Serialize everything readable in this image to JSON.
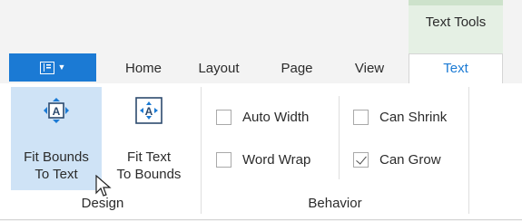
{
  "contextual_tab": {
    "title": "Text Tools"
  },
  "tabs": [
    {
      "label": "Home",
      "active": false
    },
    {
      "label": "Layout",
      "active": false
    },
    {
      "label": "Page",
      "active": false
    },
    {
      "label": "View",
      "active": false
    },
    {
      "label": "Text",
      "active": true
    }
  ],
  "app_menu": {
    "icon": "layout-panel-icon",
    "dropdown_icon": "dropdown-arrow-icon"
  },
  "groups": {
    "design": {
      "label": "Design",
      "buttons": [
        {
          "line1": "Fit Bounds",
          "line2": "To Text",
          "icon": "fit-bounds-to-text-icon",
          "hovered": true
        },
        {
          "line1": "Fit Text",
          "line2": "To Bounds",
          "icon": "fit-text-to-bounds-icon",
          "hovered": false
        }
      ]
    },
    "behavior": {
      "label": "Behavior",
      "checkboxes": [
        {
          "label": "Auto Width",
          "checked": false
        },
        {
          "label": "Word Wrap",
          "checked": false
        },
        {
          "label": "Can Shrink",
          "checked": false
        },
        {
          "label": "Can Grow",
          "checked": true
        }
      ]
    }
  },
  "colors": {
    "accent": "#1b7ad4",
    "context_band": "#e5f0e4",
    "hover": "#cfe3f6",
    "icon_dark": "#2c4a6e"
  }
}
